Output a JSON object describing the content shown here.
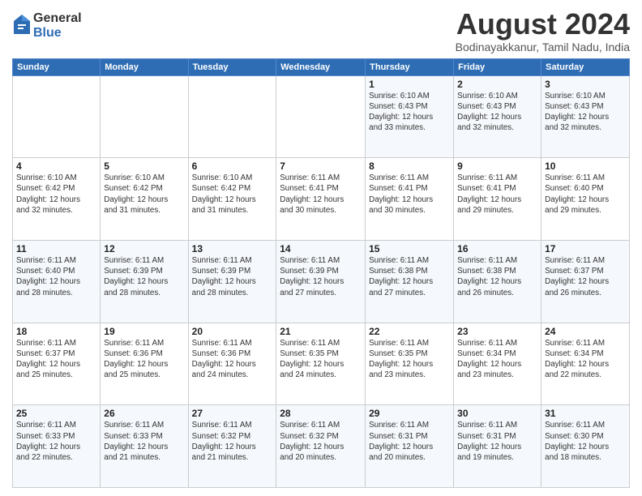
{
  "logo": {
    "general": "General",
    "blue": "Blue"
  },
  "title": "August 2024",
  "subtitle": "Bodinayakkanur, Tamil Nadu, India",
  "weekdays": [
    "Sunday",
    "Monday",
    "Tuesday",
    "Wednesday",
    "Thursday",
    "Friday",
    "Saturday"
  ],
  "weeks": [
    [
      {
        "num": "",
        "info": ""
      },
      {
        "num": "",
        "info": ""
      },
      {
        "num": "",
        "info": ""
      },
      {
        "num": "",
        "info": ""
      },
      {
        "num": "1",
        "info": "Sunrise: 6:10 AM\nSunset: 6:43 PM\nDaylight: 12 hours\nand 33 minutes."
      },
      {
        "num": "2",
        "info": "Sunrise: 6:10 AM\nSunset: 6:43 PM\nDaylight: 12 hours\nand 32 minutes."
      },
      {
        "num": "3",
        "info": "Sunrise: 6:10 AM\nSunset: 6:43 PM\nDaylight: 12 hours\nand 32 minutes."
      }
    ],
    [
      {
        "num": "4",
        "info": "Sunrise: 6:10 AM\nSunset: 6:42 PM\nDaylight: 12 hours\nand 32 minutes."
      },
      {
        "num": "5",
        "info": "Sunrise: 6:10 AM\nSunset: 6:42 PM\nDaylight: 12 hours\nand 31 minutes."
      },
      {
        "num": "6",
        "info": "Sunrise: 6:10 AM\nSunset: 6:42 PM\nDaylight: 12 hours\nand 31 minutes."
      },
      {
        "num": "7",
        "info": "Sunrise: 6:11 AM\nSunset: 6:41 PM\nDaylight: 12 hours\nand 30 minutes."
      },
      {
        "num": "8",
        "info": "Sunrise: 6:11 AM\nSunset: 6:41 PM\nDaylight: 12 hours\nand 30 minutes."
      },
      {
        "num": "9",
        "info": "Sunrise: 6:11 AM\nSunset: 6:41 PM\nDaylight: 12 hours\nand 29 minutes."
      },
      {
        "num": "10",
        "info": "Sunrise: 6:11 AM\nSunset: 6:40 PM\nDaylight: 12 hours\nand 29 minutes."
      }
    ],
    [
      {
        "num": "11",
        "info": "Sunrise: 6:11 AM\nSunset: 6:40 PM\nDaylight: 12 hours\nand 28 minutes."
      },
      {
        "num": "12",
        "info": "Sunrise: 6:11 AM\nSunset: 6:39 PM\nDaylight: 12 hours\nand 28 minutes."
      },
      {
        "num": "13",
        "info": "Sunrise: 6:11 AM\nSunset: 6:39 PM\nDaylight: 12 hours\nand 28 minutes."
      },
      {
        "num": "14",
        "info": "Sunrise: 6:11 AM\nSunset: 6:39 PM\nDaylight: 12 hours\nand 27 minutes."
      },
      {
        "num": "15",
        "info": "Sunrise: 6:11 AM\nSunset: 6:38 PM\nDaylight: 12 hours\nand 27 minutes."
      },
      {
        "num": "16",
        "info": "Sunrise: 6:11 AM\nSunset: 6:38 PM\nDaylight: 12 hours\nand 26 minutes."
      },
      {
        "num": "17",
        "info": "Sunrise: 6:11 AM\nSunset: 6:37 PM\nDaylight: 12 hours\nand 26 minutes."
      }
    ],
    [
      {
        "num": "18",
        "info": "Sunrise: 6:11 AM\nSunset: 6:37 PM\nDaylight: 12 hours\nand 25 minutes."
      },
      {
        "num": "19",
        "info": "Sunrise: 6:11 AM\nSunset: 6:36 PM\nDaylight: 12 hours\nand 25 minutes."
      },
      {
        "num": "20",
        "info": "Sunrise: 6:11 AM\nSunset: 6:36 PM\nDaylight: 12 hours\nand 24 minutes."
      },
      {
        "num": "21",
        "info": "Sunrise: 6:11 AM\nSunset: 6:35 PM\nDaylight: 12 hours\nand 24 minutes."
      },
      {
        "num": "22",
        "info": "Sunrise: 6:11 AM\nSunset: 6:35 PM\nDaylight: 12 hours\nand 23 minutes."
      },
      {
        "num": "23",
        "info": "Sunrise: 6:11 AM\nSunset: 6:34 PM\nDaylight: 12 hours\nand 23 minutes."
      },
      {
        "num": "24",
        "info": "Sunrise: 6:11 AM\nSunset: 6:34 PM\nDaylight: 12 hours\nand 22 minutes."
      }
    ],
    [
      {
        "num": "25",
        "info": "Sunrise: 6:11 AM\nSunset: 6:33 PM\nDaylight: 12 hours\nand 22 minutes."
      },
      {
        "num": "26",
        "info": "Sunrise: 6:11 AM\nSunset: 6:33 PM\nDaylight: 12 hours\nand 21 minutes."
      },
      {
        "num": "27",
        "info": "Sunrise: 6:11 AM\nSunset: 6:32 PM\nDaylight: 12 hours\nand 21 minutes."
      },
      {
        "num": "28",
        "info": "Sunrise: 6:11 AM\nSunset: 6:32 PM\nDaylight: 12 hours\nand 20 minutes."
      },
      {
        "num": "29",
        "info": "Sunrise: 6:11 AM\nSunset: 6:31 PM\nDaylight: 12 hours\nand 20 minutes."
      },
      {
        "num": "30",
        "info": "Sunrise: 6:11 AM\nSunset: 6:31 PM\nDaylight: 12 hours\nand 19 minutes."
      },
      {
        "num": "31",
        "info": "Sunrise: 6:11 AM\nSunset: 6:30 PM\nDaylight: 12 hours\nand 18 minutes."
      }
    ]
  ]
}
